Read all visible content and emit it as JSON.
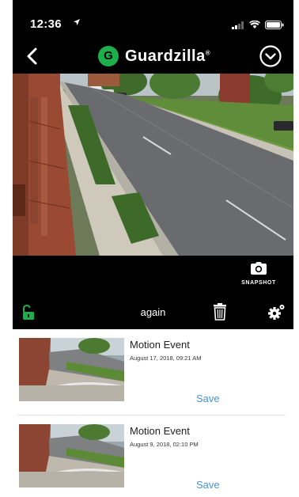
{
  "status_bar": {
    "time": "12:36"
  },
  "header": {
    "brand": "Guardzilla",
    "brand_mark": "®"
  },
  "snapshot": {
    "label": "SNAPSHOT"
  },
  "controls": {
    "camera_name": "again"
  },
  "events": [
    {
      "title": "Motion Event",
      "date": "August 17, 2018, 09:21 AM",
      "save_label": "Save"
    },
    {
      "title": "Motion Event",
      "date": "August 9, 2018, 02:10 PM",
      "save_label": "Save"
    }
  ],
  "colors": {
    "accent_green": "#1db04a",
    "link_blue": "#4a90e2",
    "background": "#000000"
  },
  "icons": {
    "location": "location-arrow-icon",
    "signal": "signal-icon",
    "wifi": "wifi-icon",
    "battery": "battery-icon",
    "back": "chevron-left-icon",
    "menu": "chevron-down-circle-icon",
    "snapshot": "camera-icon",
    "lock": "unlock-icon",
    "delete": "trash-icon",
    "settings": "gear-icon"
  }
}
